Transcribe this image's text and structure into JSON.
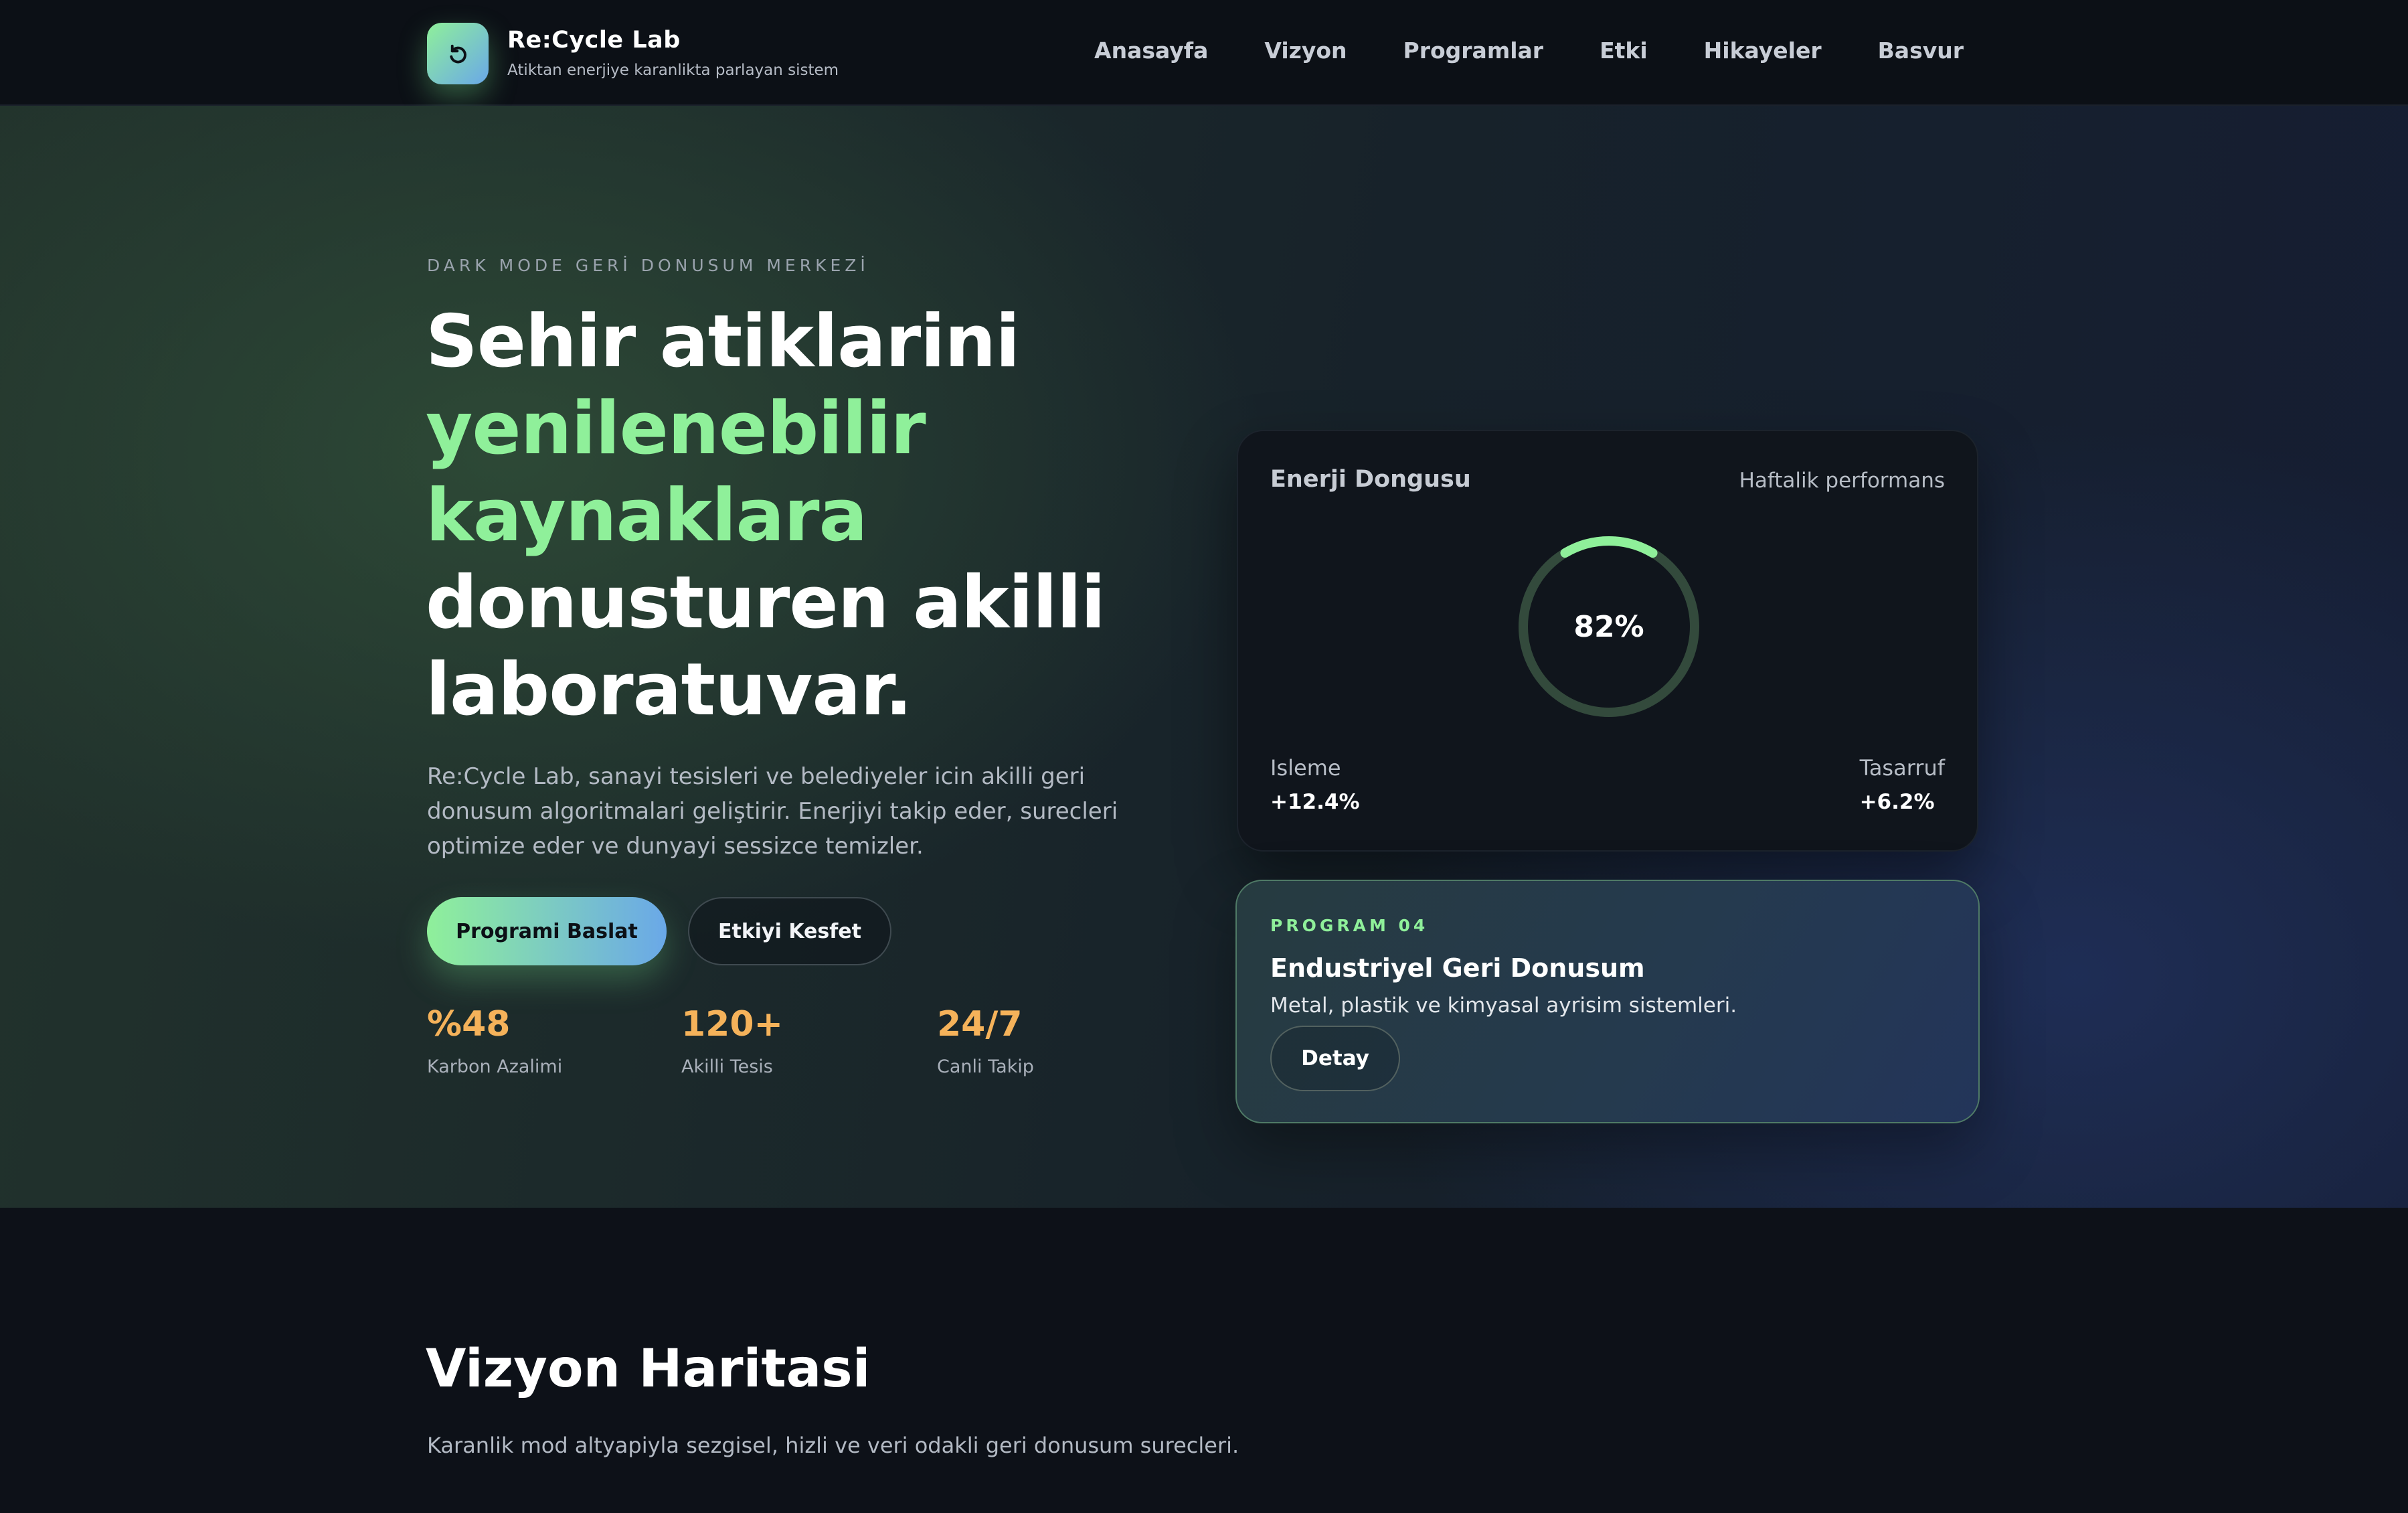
{
  "brand": {
    "name": "Re:Cycle Lab",
    "tagline": "Atiktan enerjiye karanlikta parlayan sistem",
    "logo_icon": "recycle-arrow-icon"
  },
  "nav": {
    "items": [
      "Anasayfa",
      "Vizyon",
      "Programlar",
      "Etki",
      "Hikayeler",
      "Basvur"
    ]
  },
  "hero": {
    "kicker": "DARK MODE GERİ DONUSUM MERKEZİ",
    "headline": {
      "line1": "Sehir atiklarini",
      "line2": "yenilenebilir",
      "line3": "kaynaklara",
      "line4": "donusturen akilli",
      "line5": "laboratuvar."
    },
    "lead": "Re:Cycle Lab, sanayi tesisleri ve belediyeler icin akilli geri donusum algoritmalari geliştirir. Enerjiyi takip eder, surecleri optimize eder ve dunyayi sessizce temizler.",
    "primary_button": "Programi Baslat",
    "secondary_button": "Etkiyi Kesfet",
    "stats": [
      {
        "value": "%48",
        "label": "Karbon Azalimi"
      },
      {
        "value": "120+",
        "label": "Akilli Tesis"
      },
      {
        "value": "24/7",
        "label": "Canli Takip"
      }
    ]
  },
  "energy_card": {
    "title": "Enerji Dongusu",
    "subtitle": "Haftalik performans",
    "gauge_value": "82%",
    "gauge_fraction": 0.82,
    "left_label": "Isleme",
    "left_value": "+12.4%",
    "right_label": "Tasarruf",
    "right_value": "+6.2%"
  },
  "program_card": {
    "kicker": "PROGRAM 04",
    "title": "Endustriyel Geri Donusum",
    "description": "Metal, plastik ve kimyasal ayrisim sistemleri.",
    "button": "Detay"
  },
  "vision": {
    "title": "Vizyon Haritasi",
    "description": "Karanlik mod altyapiyla sezgisel, hizli ve veri odakli geri donusum surecleri."
  },
  "colors": {
    "accent_green": "#8ff09a",
    "accent_blue": "#6aa8e8",
    "accent_orange": "#f5b25a",
    "background": "#0d1118"
  }
}
